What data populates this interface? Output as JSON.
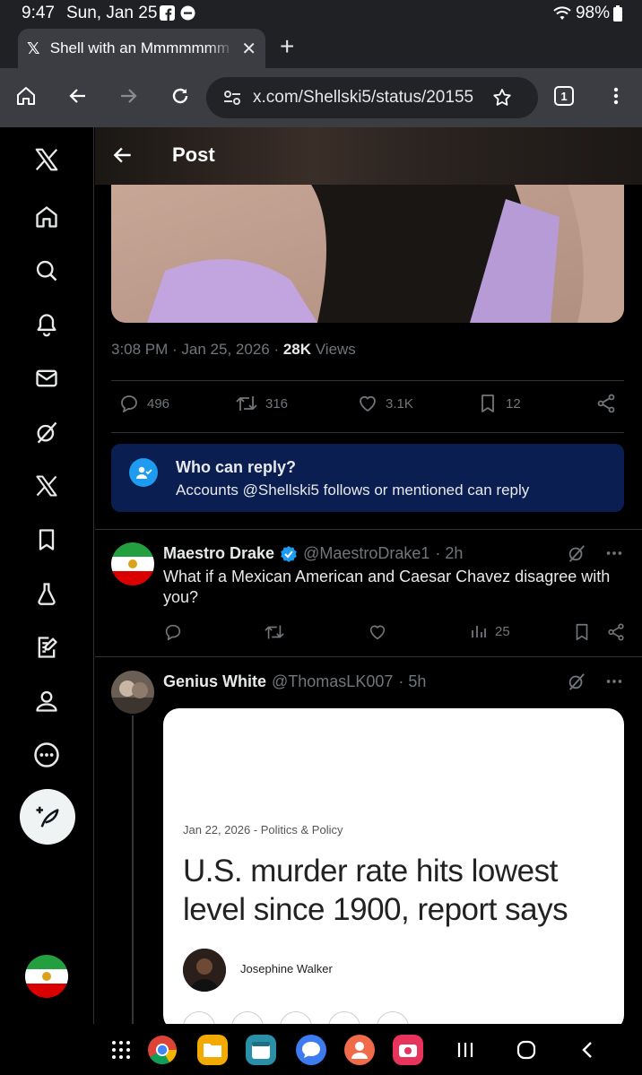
{
  "status_bar": {
    "time": "9:47",
    "date": "Sun, Jan 25",
    "battery": "98%"
  },
  "browser": {
    "tab_title": "Shell with an Mmmmmmm o",
    "url": "x.com/Shellski5/status/20155",
    "tab_count": "1"
  },
  "post": {
    "header_title": "Post",
    "time": "3:08 PM",
    "date": "Jan 25, 2026",
    "views_count": "28K",
    "views_label": "Views",
    "replies": "496",
    "reposts": "316",
    "likes": "3.1K",
    "bookmarks": "12"
  },
  "who_can_reply": {
    "title": "Who can reply?",
    "subtitle": "Accounts @Shellski5 follows or mentioned can reply"
  },
  "replies": [
    {
      "name": "Maestro Drake",
      "handle": "@MaestroDrake1",
      "age": "· 2h",
      "text": "What if a Mexican American and Caesar Chavez disagree with you?",
      "views": "25"
    },
    {
      "name": "Genius White",
      "handle": "@ThomasLK007",
      "age": "· 5h"
    }
  ],
  "article": {
    "meta": "Jan 22, 2026 - Politics & Policy",
    "title": "U.S. murder rate hits lowest level since 1900, report says",
    "author": "Josephine Walker"
  },
  "colors": {
    "accent": "#1d9bf0",
    "reply_banner": "#0b1e52",
    "muted": "#71767b"
  }
}
